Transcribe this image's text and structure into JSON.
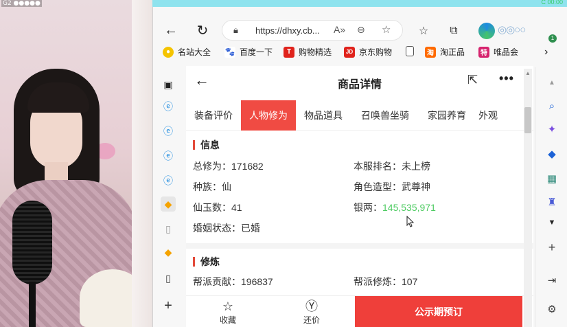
{
  "webcam": {
    "overlay_label": "G2 ●●●●●"
  },
  "browser": {
    "top_label": "C 00:00",
    "address": {
      "url": "https://dhxy.cb..."
    },
    "profile_badge": "1",
    "bookmarks": [
      {
        "label": "名站大全",
        "icon": "globe-icon",
        "color": "#f5c400"
      },
      {
        "label": "百度一下",
        "icon": "paw-icon",
        "color": "#2f5fd6"
      },
      {
        "label": "购物精选",
        "icon": "T",
        "color": "#e0231c"
      },
      {
        "label": "京东购物",
        "icon": "JD",
        "color": "#e0231c"
      },
      {
        "label": "淘正品",
        "icon": "淘",
        "color": "#ff6a00"
      },
      {
        "label": "唯品会",
        "icon": "特",
        "color": "#d6246e"
      }
    ]
  },
  "page": {
    "title": "商品详情",
    "tabs": [
      "装备评价",
      "人物修为",
      "物品道具",
      "召唤兽坐骑",
      "家园养育",
      "外观"
    ],
    "active_tab": "人物修为",
    "info": {
      "title": "信息",
      "rows": [
        {
          "k": "总修为：",
          "v": "171682"
        },
        {
          "k": "本服排名：",
          "v": "未上榜"
        },
        {
          "k": "种族：",
          "v": "仙"
        },
        {
          "k": "角色造型：",
          "v": "武尊神"
        },
        {
          "k": "仙玉数：",
          "v": "41"
        },
        {
          "k": "银两：",
          "v": "145,535,971"
        },
        {
          "k": "婚姻状态：",
          "v": "已婚"
        }
      ]
    },
    "cultivation": {
      "title": "修炼",
      "rows": [
        {
          "k": "帮派贡献：",
          "v": "196837"
        },
        {
          "k": "帮派修炼：",
          "v": "107"
        }
      ]
    },
    "bottom": {
      "collect": "收藏",
      "bargain": "还价",
      "cta": "公示期预订"
    }
  },
  "colors": {
    "accent": "#f04b43",
    "silver_green": "#4ecb62"
  }
}
